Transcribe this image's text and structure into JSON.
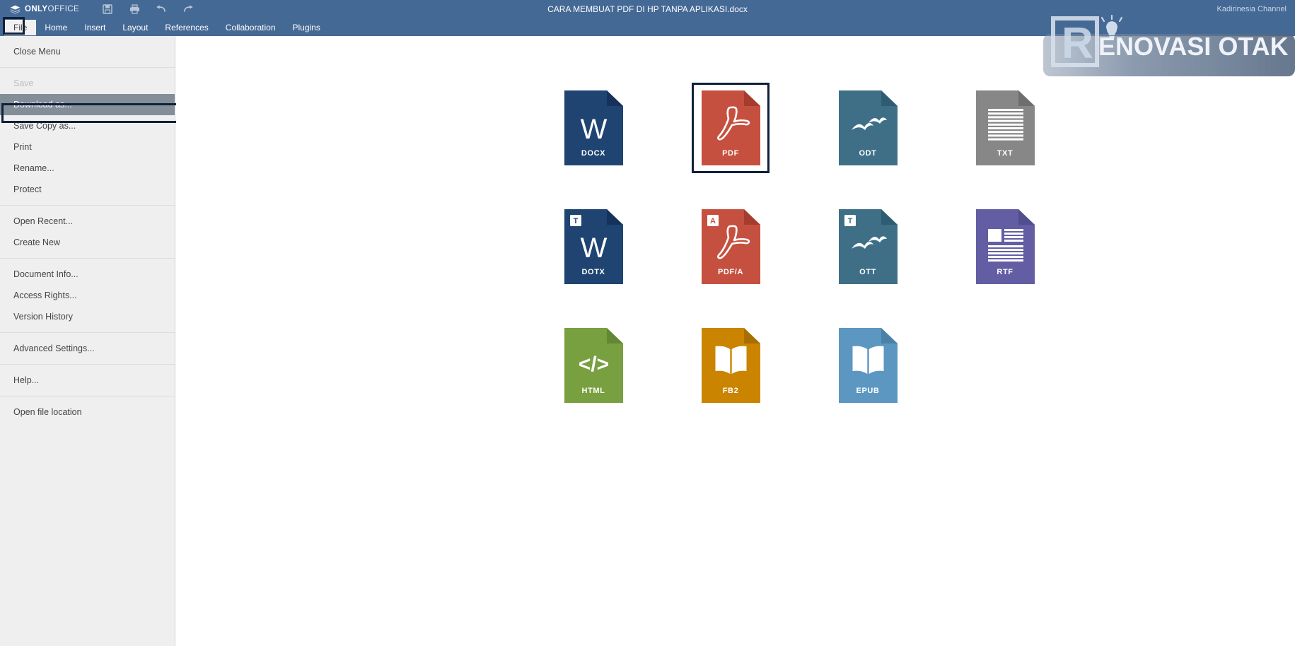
{
  "app": {
    "brand_bold": "ONLY",
    "brand_thin": "OFFICE",
    "title": "CARA MEMBUAT PDF DI HP TANPA APLIKASI.docx",
    "header_bg": "#446995",
    "annotation_color": "#10203a"
  },
  "quick_tools": [
    {
      "name": "save-icon",
      "title": "Save"
    },
    {
      "name": "print-icon",
      "title": "Print"
    },
    {
      "name": "undo-icon",
      "title": "Undo"
    },
    {
      "name": "redo-icon",
      "title": "Redo"
    }
  ],
  "header_right": {
    "channel": "Kadirinesia Channel",
    "icons": [
      {
        "name": "add-user-icon"
      },
      {
        "name": "share-icon"
      },
      {
        "name": "favorite-star-icon"
      },
      {
        "name": "hamburger-menu-icon"
      }
    ]
  },
  "tabs": [
    {
      "label": "File",
      "active": true
    },
    {
      "label": "Home",
      "active": false
    },
    {
      "label": "Insert",
      "active": false
    },
    {
      "label": "Layout",
      "active": false
    },
    {
      "label": "References",
      "active": false
    },
    {
      "label": "Collaboration",
      "active": false
    },
    {
      "label": "Plugins",
      "active": false
    }
  ],
  "file_menu": {
    "groups": [
      {
        "items": [
          {
            "label": "Close Menu",
            "state": "normal"
          }
        ]
      },
      {
        "items": [
          {
            "label": "Save",
            "state": "disabled"
          },
          {
            "label": "Download as...",
            "state": "selected"
          },
          {
            "label": "Save Copy as...",
            "state": "normal"
          },
          {
            "label": "Print",
            "state": "normal"
          },
          {
            "label": "Rename...",
            "state": "normal"
          },
          {
            "label": "Protect",
            "state": "normal"
          }
        ]
      },
      {
        "items": [
          {
            "label": "Open Recent...",
            "state": "normal"
          },
          {
            "label": "Create New",
            "state": "normal"
          }
        ]
      },
      {
        "items": [
          {
            "label": "Document Info...",
            "state": "normal"
          },
          {
            "label": "Access Rights...",
            "state": "normal"
          },
          {
            "label": "Version History",
            "state": "normal"
          }
        ]
      },
      {
        "items": [
          {
            "label": "Advanced Settings...",
            "state": "normal"
          }
        ]
      },
      {
        "items": [
          {
            "label": "Help...",
            "state": "normal"
          }
        ]
      },
      {
        "items": [
          {
            "label": "Open file location",
            "state": "normal"
          }
        ]
      }
    ]
  },
  "formats": {
    "rows": [
      [
        {
          "label": "DOCX",
          "color": "#1f4471",
          "fold": "#16325a",
          "glyph": "W",
          "selected": false,
          "badge": null
        },
        {
          "label": "PDF",
          "color": "#c6503f",
          "fold": "#a53c2d",
          "glyph": "pdf-swirl",
          "selected": true,
          "badge": null
        },
        {
          "label": "ODT",
          "color": "#3e6f87",
          "fold": "#2e5c72",
          "glyph": "birds",
          "selected": false,
          "badge": null
        },
        {
          "label": "TXT",
          "color": "#878787",
          "fold": "#6e6e6e",
          "glyph": "lines",
          "selected": false,
          "badge": null
        }
      ],
      [
        {
          "label": "DOTX",
          "color": "#1f4471",
          "fold": "#16325a",
          "glyph": "W",
          "selected": false,
          "badge": "T"
        },
        {
          "label": "PDF/A",
          "color": "#c6503f",
          "fold": "#a53c2d",
          "glyph": "pdf-swirl",
          "selected": false,
          "badge": "A"
        },
        {
          "label": "OTT",
          "color": "#3e6f87",
          "fold": "#2e5c72",
          "glyph": "birds",
          "selected": false,
          "badge": "T"
        },
        {
          "label": "RTF",
          "color": "#635ea4",
          "fold": "#524d8e",
          "glyph": "block-lines",
          "selected": false,
          "badge": null
        }
      ],
      [
        {
          "label": "HTML",
          "color": "#79a040",
          "fold": "#638734",
          "glyph": "code",
          "selected": false,
          "badge": null
        },
        {
          "label": "FB2",
          "color": "#ca8400",
          "fold": "#a96e00",
          "glyph": "book",
          "selected": false,
          "badge": null
        },
        {
          "label": "EPUB",
          "color": "#5c97c2",
          "fold": "#4b81a9",
          "glyph": "book",
          "selected": false,
          "badge": null
        }
      ]
    ]
  },
  "watermark": {
    "letter": "R",
    "text": "ENOVASI OTAK",
    "name": "renovasi-otak-logo"
  }
}
